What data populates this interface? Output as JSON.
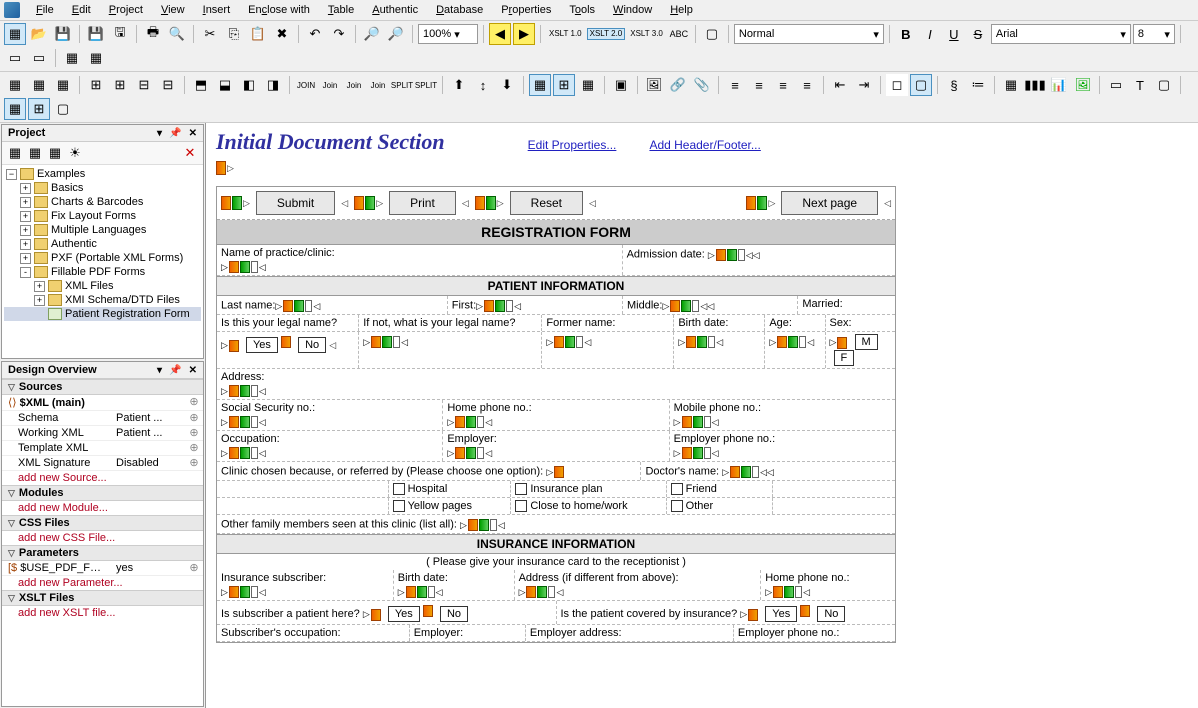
{
  "menu": [
    "File",
    "Edit",
    "Project",
    "View",
    "Insert",
    "Enclose with",
    "Table",
    "Authentic",
    "Database",
    "Properties",
    "Tools",
    "Window",
    "Help"
  ],
  "toolbar": {
    "zoom": "100%",
    "style": "Normal",
    "font": "Arial",
    "size": "8",
    "xslt": [
      "XSLT 1.0",
      "XSLT 2.0",
      "XSLT 3.0"
    ]
  },
  "project_panel": {
    "title": "Project",
    "root": "Examples",
    "items": [
      {
        "label": "Basics",
        "level": 1,
        "expand": "+"
      },
      {
        "label": "Charts & Barcodes",
        "level": 1,
        "expand": "+"
      },
      {
        "label": "Fix Layout Forms",
        "level": 1,
        "expand": "+"
      },
      {
        "label": "Multiple Languages",
        "level": 1,
        "expand": "+"
      },
      {
        "label": "Authentic",
        "level": 1,
        "expand": "+"
      },
      {
        "label": "PXF (Portable XML Forms)",
        "level": 1,
        "expand": "+"
      },
      {
        "label": "Fillable PDF Forms",
        "level": 1,
        "expand": "-"
      },
      {
        "label": "XML Files",
        "level": 2,
        "expand": "+"
      },
      {
        "label": "XMI Schema/DTD Files",
        "level": 2,
        "expand": "+"
      },
      {
        "label": "Patient Registration Form",
        "level": 2,
        "expand": "",
        "selected": true,
        "file": true
      }
    ]
  },
  "overview_panel": {
    "title": "Design Overview",
    "sections": {
      "sources": {
        "title": "Sources",
        "main": "$XML (main)",
        "rows": [
          {
            "k": "Schema",
            "v": "Patient ..."
          },
          {
            "k": "Working XML",
            "v": "Patient ..."
          },
          {
            "k": "Template XML",
            "v": ""
          },
          {
            "k": "XML Signature",
            "v": "Disabled"
          }
        ],
        "add": "add new Source..."
      },
      "modules": {
        "title": "Modules",
        "add": "add new Module..."
      },
      "css": {
        "title": "CSS Files",
        "add": "add new CSS File..."
      },
      "params": {
        "title": "Parameters",
        "rows": [
          {
            "k": "$USE_PDF_FORM",
            "v": "yes"
          }
        ],
        "add": "add new Parameter..."
      },
      "xslt": {
        "title": "XSLT Files",
        "add": "add new XSLT file..."
      }
    }
  },
  "design": {
    "section_title": "Initial Document Section",
    "link_edit": "Edit Properties...",
    "link_header": "Add Header/Footer...",
    "buttons": {
      "submit": "Submit",
      "print": "Print",
      "reset": "Reset",
      "next": "Next page"
    },
    "form_header": "REGISTRATION FORM",
    "row1": {
      "practice": "Name of practice/clinic:",
      "admission": "Admission date:"
    },
    "patient_info": "PATIENT INFORMATION",
    "row2": {
      "last": "Last name:",
      "first": "First:",
      "middle": "Middle:",
      "married": "Married:"
    },
    "row3": {
      "legal": "Is this your legal name?",
      "ifnot": "If not, what is your legal name?",
      "former": "Former name:",
      "birth": "Birth date:",
      "age": "Age:",
      "sex": "Sex:"
    },
    "row3b": {
      "yes": "Yes",
      "no": "No",
      "m": "M",
      "f": "F"
    },
    "row4": {
      "address": "Address:"
    },
    "row5": {
      "ssn": "Social Security no.:",
      "home": "Home phone no.:",
      "mobile": "Mobile phone no.:"
    },
    "row6": {
      "occ": "Occupation:",
      "emp": "Employer:",
      "empph": "Employer phone no.:"
    },
    "row7": {
      "clinic": "Clinic chosen because, or referred by (Please choose one option):",
      "doctor": "Doctor's name:"
    },
    "row7b": {
      "hospital": "Hospital",
      "insurance": "Insurance plan",
      "friend": "Friend",
      "yellow": "Yellow pages",
      "close": "Close to home/work",
      "other": "Other"
    },
    "row8": {
      "family": "Other family members seen at this clinic (list all):"
    },
    "insurance_info": "INSURANCE INFORMATION",
    "insurance_note": "( Please give your insurance card to the receptionist )",
    "row9": {
      "sub": "Insurance subscriber:",
      "birth": "Birth date:",
      "addr": "Address (if different from above):",
      "home": "Home phone no.:"
    },
    "row10": {
      "subpat": "Is subscriber a patient here?",
      "yes": "Yes",
      "no": "No",
      "covered": "Is the patient covered by insurance?",
      "yes2": "Yes",
      "no2": "No"
    },
    "row11": {
      "subocc": "Subscriber's occupation:",
      "emp": "Employer:",
      "empaddr": "Employer address:",
      "empph": "Employer phone no.:"
    }
  }
}
